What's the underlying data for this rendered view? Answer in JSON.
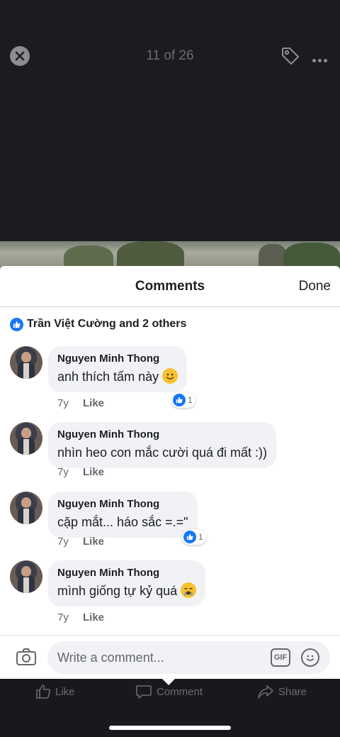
{
  "viewer": {
    "counter": "11 of 26",
    "close_icon": "close-icon",
    "tag_icon": "tag-icon",
    "more_icon": "more-icon"
  },
  "sheet": {
    "title": "Comments",
    "done_label": "Done",
    "likes_summary": "Trần Việt Cường and 2 others"
  },
  "comments": [
    {
      "author": "Nguyen Minh Thong",
      "text": "anh thích tấm này",
      "emoji": "slightly-smiling-face",
      "age": "7y",
      "like_label": "Like",
      "reaction_count": "1"
    },
    {
      "author": "Nguyen Minh Thong",
      "text": "nhìn heo con mắc cười quá đi mất :))",
      "emoji": "",
      "age": "7y",
      "like_label": "Like",
      "reaction_count": ""
    },
    {
      "author": "Nguyen Minh Thong",
      "text": "cặp mắt... háo sắc =.=\"",
      "emoji": "",
      "age": "7y",
      "like_label": "Like",
      "reaction_count": "1"
    },
    {
      "author": "Nguyen Minh Thong",
      "text": "mình giống tự kỷ quá",
      "emoji": "loudly-crying-face",
      "age": "7y",
      "like_label": "Like",
      "reaction_count": ""
    }
  ],
  "compose": {
    "placeholder": "Write a comment...",
    "gif_label": "GIF",
    "camera_icon": "camera-icon",
    "emoji_icon": "emoji-icon"
  },
  "actions": {
    "like_label": "Like",
    "comment_label": "Comment",
    "share_label": "Share"
  },
  "colors": {
    "accent": "#1877f2",
    "bubble": "#f0f2f5",
    "viewer_bg": "#1b1c20"
  }
}
